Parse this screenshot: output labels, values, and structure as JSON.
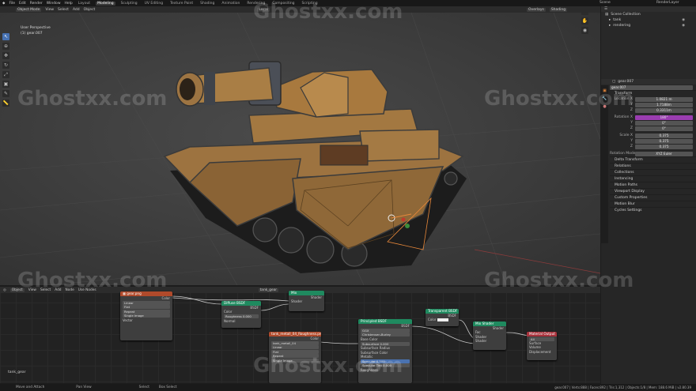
{
  "menubar": {
    "menus": [
      "File",
      "Edit",
      "Render",
      "Window",
      "Help"
    ],
    "workspaces": [
      "Layout",
      "Modeling",
      "Sculpting",
      "UV Editing",
      "Texture Paint",
      "Shading",
      "Animation",
      "Rendering",
      "Compositing",
      "Scripting"
    ],
    "active_workspace": "Modeling",
    "scene": "Scene",
    "view_layer": "RenderLayer"
  },
  "viewport": {
    "mode": "Object Mode",
    "menus": [
      "View",
      "Select",
      "Add",
      "Object"
    ],
    "orientation": "Local",
    "overlays_label": "Overlays",
    "shading_label": "Shading",
    "view_name": "User Perspective",
    "object_info": "(1) gear.007"
  },
  "outliner": {
    "root": "Scene Collection",
    "items": [
      {
        "name": "tank"
      },
      {
        "name": "rendering"
      }
    ]
  },
  "properties": {
    "object_name": "gear.007",
    "object_name_field": "gear.007",
    "transform_header": "Transform",
    "location": {
      "label": "Location X",
      "x": "1.0821 m",
      "y": "1.7188m",
      "z": "0.3311m"
    },
    "rotation": {
      "label": "Rotation X",
      "x": "180°",
      "y": "0°",
      "z": "0°"
    },
    "scale": {
      "label": "Scale X",
      "x": "0.375",
      "y": "0.375",
      "z": "0.375"
    },
    "rotation_mode_label": "Rotation Mode",
    "rotation_mode": "XYZ Euler",
    "sections": [
      "Delta Transform",
      "Relations",
      "Collections",
      "Instancing",
      "Motion Paths",
      "Viewport Display",
      "Custom Properties",
      "Motion Blur",
      "Cycles Settings"
    ]
  },
  "node_editor": {
    "menus": [
      "View",
      "Select",
      "Add",
      "Node"
    ],
    "object_label": "Object",
    "use_nodes": "Use Nodes",
    "material_name": "tank_gear",
    "frame_label": "tank_gear",
    "nodes": {
      "image_tex1": {
        "title": "gear.png",
        "rows": [
          "Color",
          "Alpha",
          "Linear",
          "Flat",
          "Repeat",
          "Single Image",
          "Vector"
        ]
      },
      "mix1": {
        "title": "Mix",
        "rows": [
          "Shader",
          "Shader",
          "Shader"
        ]
      },
      "diffuse": {
        "title": "Diffuse BSDF",
        "rows": [
          "BSDF",
          "Color",
          "Roughness",
          "0.000",
          "Normal"
        ]
      },
      "image_tex2": {
        "title": "tank_metall_04_Roughness.png",
        "rows": [
          "Color",
          "Alpha",
          "tank_metall_04",
          "Linear",
          "Flat",
          "Repeat",
          "Single Image"
        ]
      },
      "principled": {
        "title": "Principled BSDF",
        "rows": [
          "BSDF",
          "GGX",
          "Christensen-Burley",
          "Base Color",
          "Subsurface",
          "0.000",
          "Subsurface Radius",
          "Subsurface Color",
          "Metallic",
          "Specular",
          "0.500",
          "Specular Tint",
          "0.000",
          "Roughness"
        ]
      },
      "transparent": {
        "title": "Transparent BSDF",
        "rows": [
          "BSDF",
          "Color"
        ]
      },
      "mix2": {
        "title": "Mix Shader",
        "rows": [
          "Shader",
          "Fac",
          "Shader",
          "Shader"
        ]
      },
      "output": {
        "title": "Material Output",
        "rows": [
          "All",
          "Surface",
          "Volume",
          "Displacement"
        ]
      }
    }
  },
  "statusbar": {
    "left": [
      "Move and Attach",
      "Pan View",
      "Select",
      "Box Select"
    ],
    "right": "gear.007 | Verts:888 | Faces:892 | Tris:1,312 | Objects:1/8 | Mem: 188.6 MiB | v2.80.39"
  },
  "watermark": "Ghostxx.com",
  "colors": {
    "accent": "#4772b3",
    "node_input": "#b04a2b",
    "node_shader": "#1f8a5f",
    "node_output": "#a8323c",
    "highlight": "#9a3db0"
  }
}
